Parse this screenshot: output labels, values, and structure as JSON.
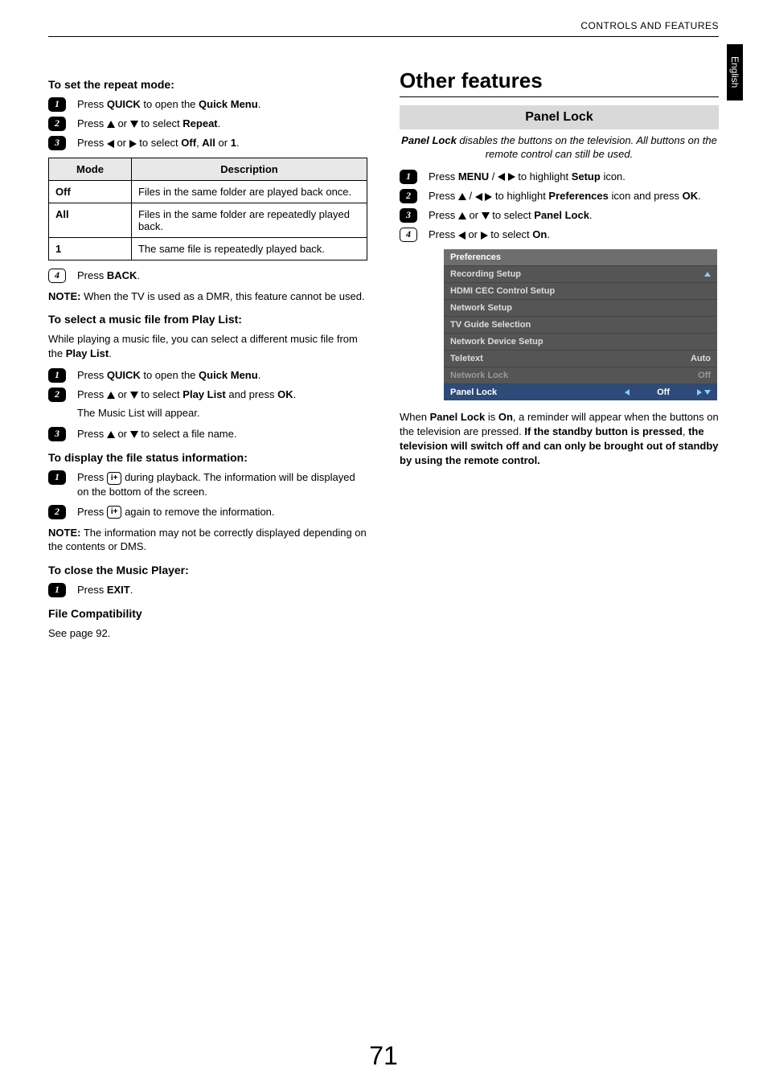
{
  "header": "CONTROLS AND FEATURES",
  "side_tab": "English",
  "page_number": "71",
  "left": {
    "set_repeat": {
      "heading": "To set the repeat mode:",
      "s1_a": "Press ",
      "s1_b": "QUICK",
      "s1_c": " to open the ",
      "s1_d": "Quick Menu",
      "s1_e": ".",
      "s2_a": "Press ",
      "s2_b": " or ",
      "s2_c": " to select ",
      "s2_d": "Repeat",
      "s2_e": ".",
      "s3_a": "Press ",
      "s3_b": " or ",
      "s3_c": " to select ",
      "s3_d": "Off",
      "s3_e": ", ",
      "s3_f": "All",
      "s3_g": " or ",
      "s3_h": "1",
      "s3_i": "."
    },
    "mode_table": {
      "col_mode": "Mode",
      "col_desc": "Description",
      "row1_mode": "Off",
      "row1_desc": "Files in the same folder are played back once.",
      "row2_mode": "All",
      "row2_desc": "Files in the same folder are repeatedly played back.",
      "row3_mode": "1",
      "row3_desc": "The same file is repeatedly played back."
    },
    "back_step_a": "Press ",
    "back_step_b": "BACK",
    "back_step_c": ".",
    "note_dmr_a": "NOTE:",
    "note_dmr_b": " When the TV is used as a DMR, this feature cannot be used.",
    "select_music": {
      "heading": "To select a music file from Play List:",
      "intro_a": "While playing a music file, you can select a different music file from the ",
      "intro_b": "Play List",
      "intro_c": ".",
      "s1_a": "Press ",
      "s1_b": "QUICK",
      "s1_c": " to open the ",
      "s1_d": "Quick Menu",
      "s1_e": ".",
      "s2_a": "Press ",
      "s2_b": " or ",
      "s2_c": " to select ",
      "s2_d": "Play List",
      "s2_e": " and press ",
      "s2_f": "OK",
      "s2_g": ".",
      "s2_sub": "The Music List will appear.",
      "s3_a": "Press ",
      "s3_b": " or ",
      "s3_c": " to select a file name."
    },
    "display_info": {
      "heading": "To display the file status information:",
      "s1_a": "Press ",
      "s1_b": " during playback. The information will be displayed on the bottom of the screen.",
      "s2_a": "Press ",
      "s2_b": " again to remove the information."
    },
    "note_info_a": "NOTE:",
    "note_info_b": " The information may not be correctly displayed depending on the contents or DMS.",
    "close_player": {
      "heading": "To close the Music Player:",
      "s1_a": "Press ",
      "s1_b": "EXIT",
      "s1_c": "."
    },
    "file_compat": {
      "heading": "File Compatibility",
      "body": "See page 92."
    }
  },
  "right": {
    "section_title": "Other features",
    "panel_lock": {
      "bar": "Panel Lock",
      "desc_a": "Panel Lock",
      "desc_b": " disables the buttons on the television. All buttons on the remote control can still be used.",
      "s1_a": "Press ",
      "s1_b": "MENU",
      "s1_c": " / ",
      "s1_d": " to highlight ",
      "s1_e": "Setup",
      "s1_f": " icon.",
      "s2_a": "Press ",
      "s2_b": " / ",
      "s2_c": " to highlight ",
      "s2_d": "Preferences",
      "s2_e": " icon and press ",
      "s2_f": "OK",
      "s2_g": ".",
      "s3_a": "Press ",
      "s3_b": " or ",
      "s3_c": " to select ",
      "s3_d": "Panel Lock",
      "s3_e": ".",
      "s4_a": "Press ",
      "s4_b": " or ",
      "s4_c": " to select ",
      "s4_d": "On",
      "s4_e": "."
    },
    "pref_panel": {
      "title": "Preferences",
      "rows": [
        {
          "label": "Recording Setup",
          "value": ""
        },
        {
          "label": "HDMI CEC Control Setup",
          "value": ""
        },
        {
          "label": "Network Setup",
          "value": ""
        },
        {
          "label": "TV Guide Selection",
          "value": ""
        },
        {
          "label": "Network Device Setup",
          "value": ""
        },
        {
          "label": "Teletext",
          "value": "Auto"
        },
        {
          "label": "Network Lock",
          "value": "Off"
        },
        {
          "label": "Panel Lock",
          "value": "Off"
        }
      ]
    },
    "bottom_a": "When ",
    "bottom_b": "Panel Lock",
    "bottom_c": " is ",
    "bottom_d": "On",
    "bottom_e": ", a reminder will appear when the buttons on the television are pressed. ",
    "bottom_f": "If the standby button is pressed",
    "bottom_g": ", ",
    "bottom_h": "the television will switch off and can only be brought out of standby by using the remote control."
  }
}
